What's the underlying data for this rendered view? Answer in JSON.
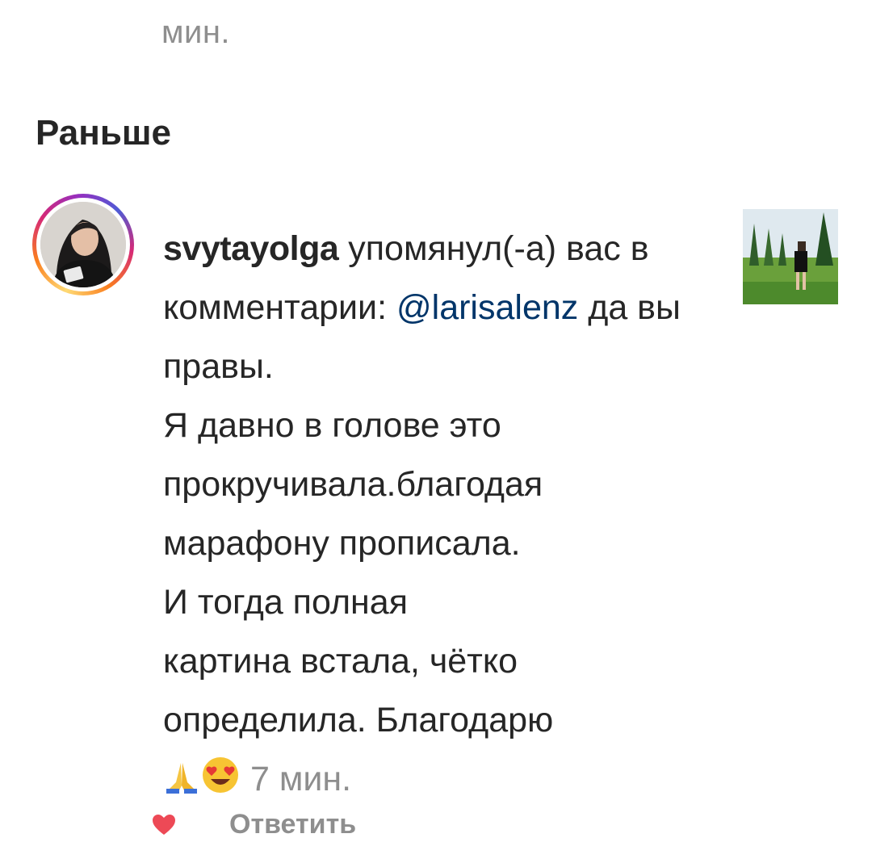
{
  "top_time": "мин.",
  "section_title": "Раньше",
  "notification": {
    "username": "svytayolga",
    "action": " упомянул(-а) вас в комментарии: ",
    "mention": "@larisalenz",
    "comment_lines": [
      " да вы правы.",
      "Я давно в голове это",
      "прокручивала.благодая",
      "марафону прописала.",
      "И тогда полная",
      "картина встала, чётко",
      "определила. Благодарю"
    ],
    "emojis": [
      "folded-hands-icon",
      "heart-eyes-icon"
    ],
    "time": "7 мин."
  },
  "actions": {
    "like_icon": "heart-icon",
    "reply_label": "Ответить"
  },
  "colors": {
    "text": "#262626",
    "secondary": "#8e8e8e",
    "mention": "#003569",
    "like": "#ed4956"
  }
}
